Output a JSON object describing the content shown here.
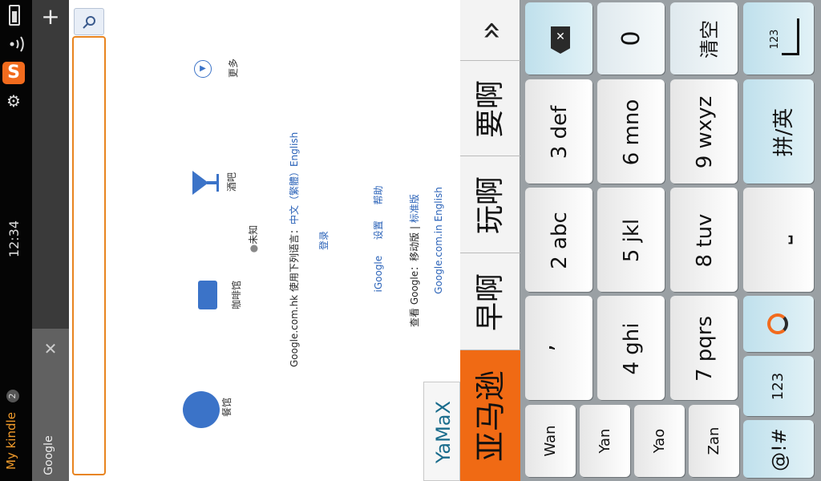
{
  "status": {
    "time": "12:34",
    "app_label": "My kindle",
    "app_badge": "2",
    "sogou_icon": "sogou-input-icon",
    "icons": [
      "battery-icon",
      "wifi-icon",
      "sogou-input-icon",
      "gear-icon"
    ]
  },
  "browser": {
    "tab_title": "Google",
    "add_tab": "+",
    "close_tab": "✕"
  },
  "google": {
    "local_items": [
      {
        "label": "餐馆",
        "icon": "restaurant-icon"
      },
      {
        "label": "咖啡馆",
        "icon": "coffee-icon"
      },
      {
        "label": "酒吧",
        "icon": "cocktail-icon"
      },
      {
        "label": "更多",
        "icon": "play-more-icon"
      }
    ],
    "location": "未知",
    "language_prefix": "Google.com.hk 使用下列语言：",
    "language_links": "中文（繁體）English",
    "login": "登录",
    "footer_links": [
      "iGoogle",
      "设置",
      "帮助"
    ],
    "view_prefix": "查看 Google：移动版 |",
    "standard_link": "标准版",
    "english_link": "Google.com.in English"
  },
  "ime": {
    "composition": "YaMaX",
    "candidates": [
      "亚马逊",
      "早啊",
      "玩啊",
      "要啊"
    ],
    "expand": "»",
    "pinyin_suggestions": [
      "Wan",
      "Yan",
      "Yao",
      "Zan"
    ],
    "keys": {
      "backspace": "⌫",
      "zero": "0",
      "clear": "清空",
      "enter_label": "123",
      "apostrophe": "’",
      "k2": "2 abc",
      "k3": "3 def",
      "k4": "4 ghi",
      "k5": "5 jkl",
      "k6": "6 mno",
      "k7": "7 pqrs",
      "k8": "8 tuv",
      "k9": "9 wxyz",
      "sym": "@!#",
      "num": "123",
      "space": "⎵",
      "lang": "拼/英"
    }
  }
}
